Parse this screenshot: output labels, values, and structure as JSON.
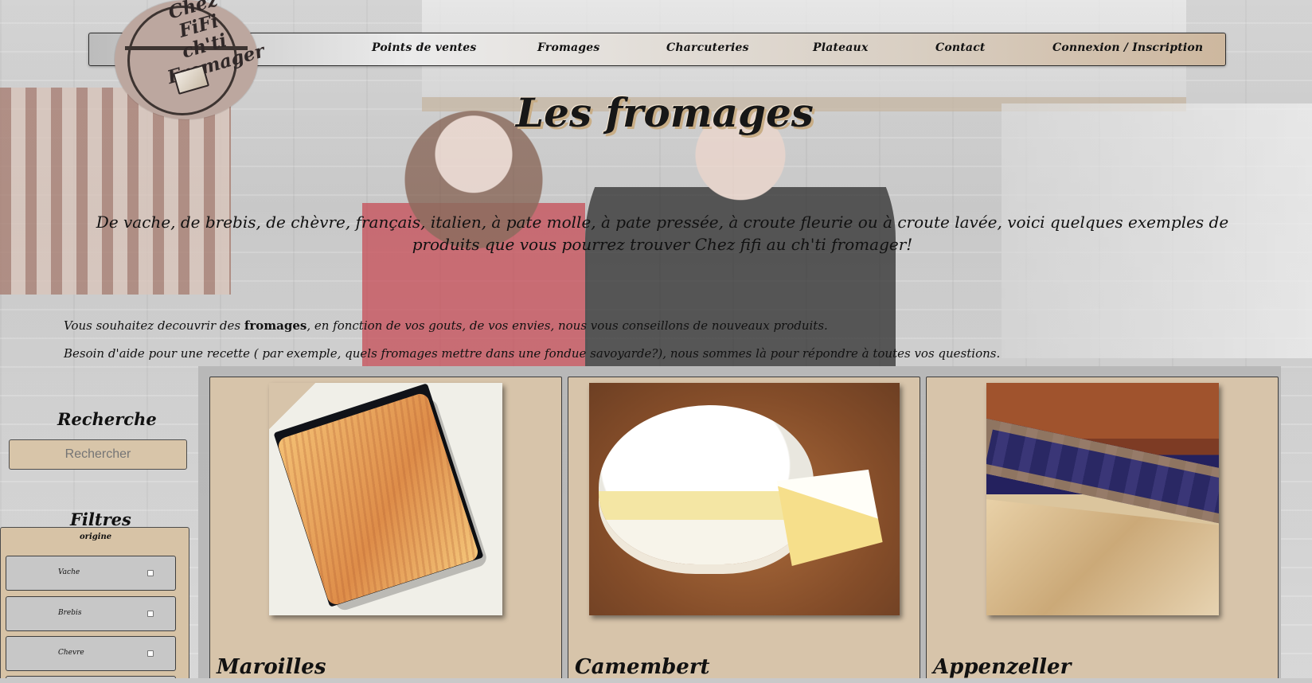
{
  "brand": {
    "logo_text": "Chez\nFiFi ch'ti\nFromager"
  },
  "navigation": [
    {
      "label": "Points de ventes"
    },
    {
      "label": "Fromages"
    },
    {
      "label": "Charcuteries"
    },
    {
      "label": "Plateaux"
    },
    {
      "label": "Contact"
    },
    {
      "label": "Connexion / Inscription"
    }
  ],
  "hero": {
    "title": "Les fromages",
    "intro": "De vache, de brebis, de chèvre, français, italien, à pate molle, à pate pressée, à croute fleurie ou à croute lavée, voici quelques exemples de produits que vous pourrez trouver Chez fifi au ch'ti fromager!",
    "note_line_1_prefix": "Vous souhaitez decouvrir des ",
    "note_line_1_emphasis": "fromages",
    "note_line_1_suffix": ", en fonction de vos gouts, de vos envies, nous vous conseillons de nouveaux produits.",
    "note_line_2": "Besoin d'aide pour une recette ( par exemple, quels fromages mettre dans une fondue savoyarde?), nous sommes là pour répondre à toutes vos questions."
  },
  "sidebar": {
    "search_heading": "Recherche",
    "search_placeholder": "Rechercher",
    "filters_heading": "Filtres",
    "filter_group": "origine",
    "filters": [
      {
        "label": "Vache"
      },
      {
        "label": "Brebis"
      },
      {
        "label": "Chevre"
      }
    ]
  },
  "products": [
    {
      "name": "Maroilles"
    },
    {
      "name": "Camembert"
    },
    {
      "name": "Appenzeller"
    }
  ],
  "colors": {
    "tan": "#d7c4aa",
    "nav_tan": "#cdb79e",
    "gray_panel": "#b7b7b7",
    "text": "#111111"
  }
}
